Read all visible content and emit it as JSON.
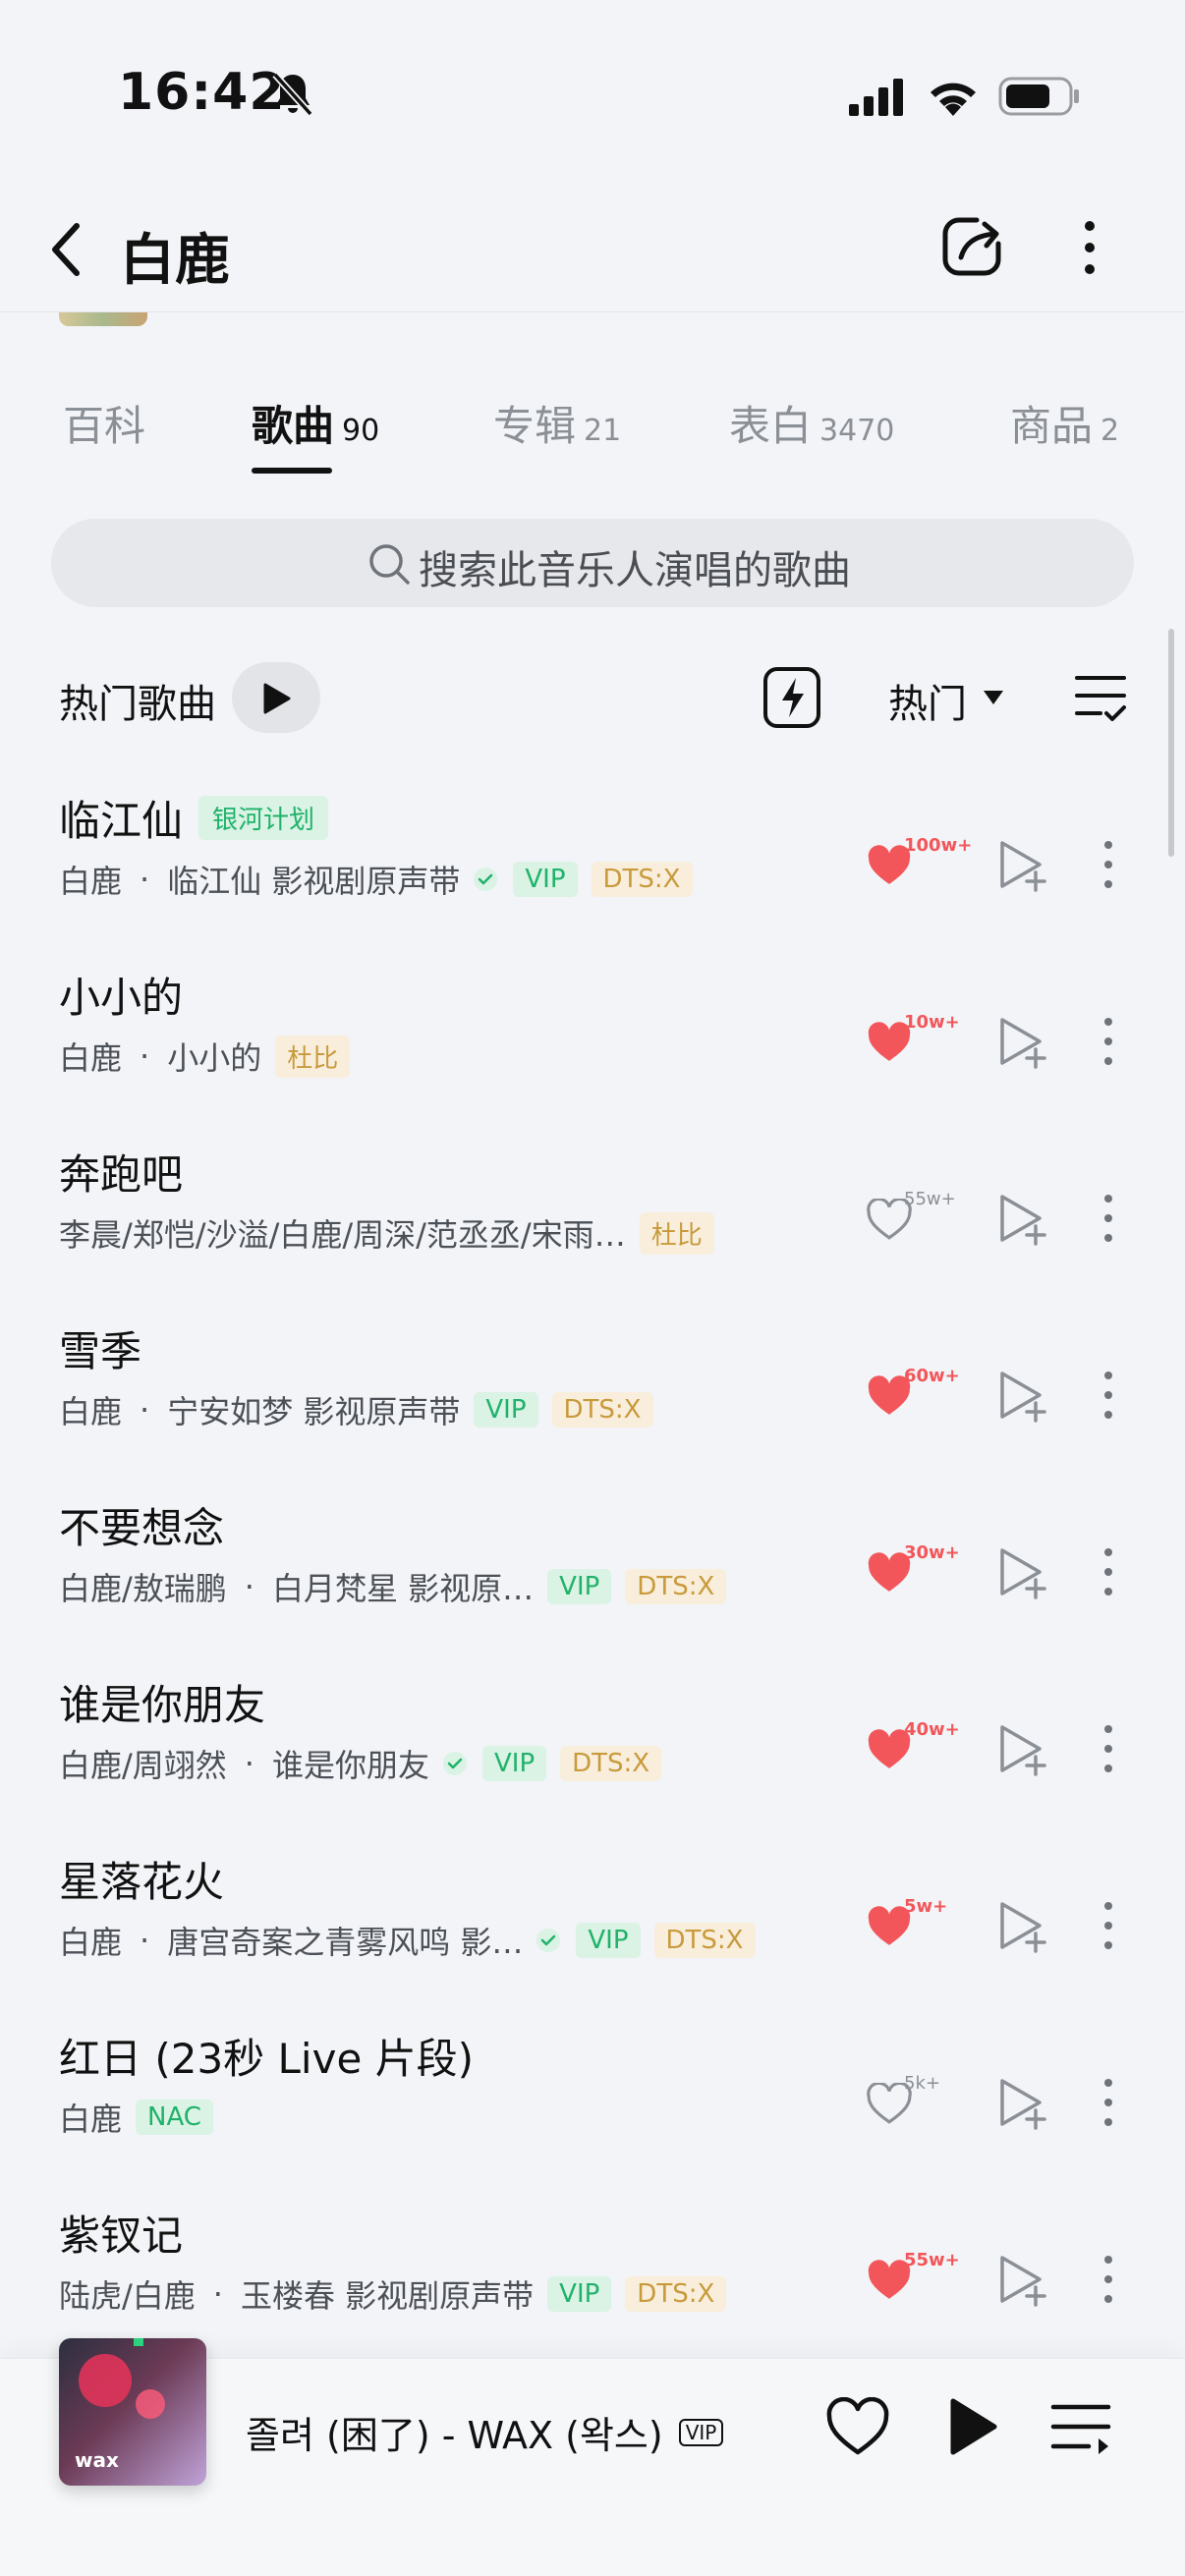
{
  "status_bar": {
    "time": "16:42"
  },
  "nav": {
    "title": "白鹿"
  },
  "tabs": [
    {
      "label": "百科",
      "count": ""
    },
    {
      "label": "歌曲",
      "count": "90"
    },
    {
      "label": "专辑",
      "count": "21"
    },
    {
      "label": "表白",
      "count": "3470"
    },
    {
      "label": "商品",
      "count": "2"
    }
  ],
  "search": {
    "placeholder": "搜索此音乐人演唱的歌曲"
  },
  "list_header": {
    "title": "热门歌曲",
    "sort_label": "热门"
  },
  "songs": [
    {
      "title": "临江仙",
      "title_tag": "银河计划",
      "artist": "白鹿",
      "album": "临江仙 影视剧原声带",
      "verified": true,
      "tags": [
        "VIP",
        "DTS:X"
      ],
      "likes": "100w+",
      "liked": true
    },
    {
      "title": "小小的",
      "title_tag": "",
      "artist": "白鹿",
      "album": "小小的",
      "verified": false,
      "tags": [
        "杜比"
      ],
      "likes": "10w+",
      "liked": true
    },
    {
      "title": "奔跑吧",
      "title_tag": "",
      "artist": "李晨/郑恺/沙溢/白鹿/周深/范丞丞/宋雨…",
      "album": "",
      "verified": false,
      "tags": [
        "杜比"
      ],
      "likes": "55w+",
      "liked": false
    },
    {
      "title": "雪季",
      "title_tag": "",
      "artist": "白鹿",
      "album": "宁安如梦 影视原声带",
      "verified": false,
      "tags": [
        "VIP",
        "DTS:X"
      ],
      "likes": "60w+",
      "liked": true
    },
    {
      "title": "不要想念",
      "title_tag": "",
      "artist": "白鹿/敖瑞鹏",
      "album": "白月梵星 影视原…",
      "verified": false,
      "tags": [
        "VIP",
        "DTS:X"
      ],
      "likes": "30w+",
      "liked": true
    },
    {
      "title": "谁是你朋友",
      "title_tag": "",
      "artist": "白鹿/周翊然",
      "album": "谁是你朋友",
      "verified": true,
      "tags": [
        "VIP",
        "DTS:X"
      ],
      "likes": "40w+",
      "liked": true
    },
    {
      "title": "星落花火",
      "title_tag": "",
      "artist": "白鹿",
      "album": "唐宫奇案之青雾风鸣 影…",
      "verified": true,
      "tags": [
        "VIP",
        "DTS:X"
      ],
      "likes": "5w+",
      "liked": true
    },
    {
      "title": "红日 (23秒 Live 片段)",
      "title_tag": "",
      "artist": "白鹿",
      "album": "",
      "verified": false,
      "tags": [
        "NAC"
      ],
      "likes": "5k+",
      "liked": false
    },
    {
      "title": "紫钗记",
      "title_tag": "",
      "artist": "陆虎/白鹿",
      "album": "玉楼春 影视剧原声带",
      "verified": false,
      "tags": [
        "VIP",
        "DTS:X"
      ],
      "likes": "55w+",
      "liked": true
    }
  ],
  "player": {
    "title": "졸려 (困了) - WAX (왁스)",
    "vip_label": "VIP",
    "cover_label": "wax"
  },
  "colors": {
    "accent_green": "#20b26b",
    "like_red": "#f2565a",
    "dts_gold": "#c89a3c"
  }
}
